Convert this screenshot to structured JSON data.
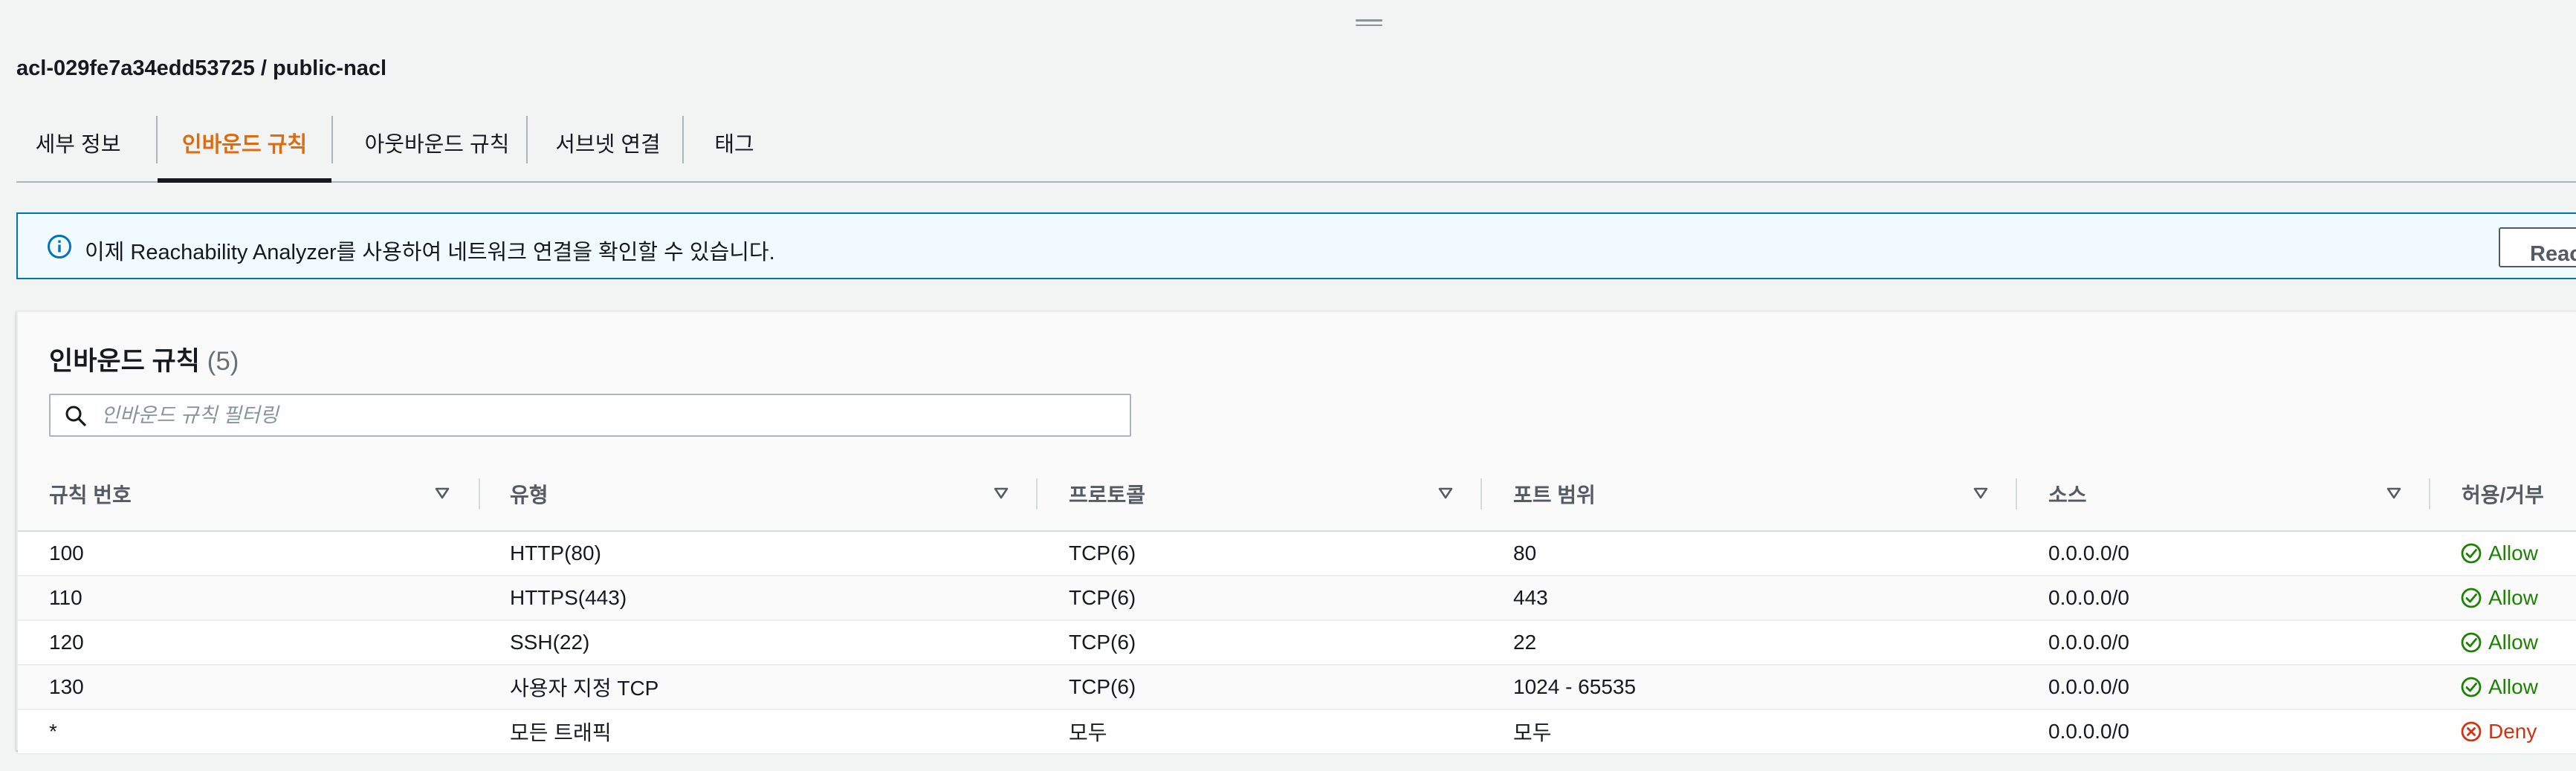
{
  "header": {
    "title": "acl-029fe7a34edd53725 / public-nacl"
  },
  "tabs": [
    {
      "label": "세부 정보",
      "active": false
    },
    {
      "label": "인바운드 규칙",
      "active": true
    },
    {
      "label": "아웃바운드 규칙",
      "active": false
    },
    {
      "label": "서브넷 연결",
      "active": false
    },
    {
      "label": "태그",
      "active": false
    }
  ],
  "flash": {
    "icon": "info-icon",
    "message": "이제 Reachability Analyzer를 사용하여 네트워크 연결을 확인할 수 있습니다.",
    "button_label": "Reachability Analyzer 실행"
  },
  "panel": {
    "title": "인바운드 규칙",
    "count": "(5)",
    "filter_placeholder": "인바운드 규칙 필터링",
    "filter_value": ""
  },
  "table": {
    "columns": [
      "규칙 번호",
      "유형",
      "프로토콜",
      "포트 범위",
      "소스",
      "허용/거부"
    ],
    "rows": [
      {
        "rule": "100",
        "type": "HTTP(80)",
        "protocol": "TCP(6)",
        "port": "80",
        "source": "0.0.0.0/0",
        "action": "Allow"
      },
      {
        "rule": "110",
        "type": "HTTPS(443)",
        "protocol": "TCP(6)",
        "port": "443",
        "source": "0.0.0.0/0",
        "action": "Allow"
      },
      {
        "rule": "120",
        "type": "SSH(22)",
        "protocol": "TCP(6)",
        "port": "22",
        "source": "0.0.0.0/0",
        "action": "Allow"
      },
      {
        "rule": "130",
        "type": "사용자 지정 TCP",
        "protocol": "TCP(6)",
        "port": "1024 - 65535",
        "source": "0.0.0.0/0",
        "action": "Allow"
      },
      {
        "rule": "*",
        "type": "모든 트래픽",
        "protocol": "모두",
        "port": "모두",
        "source": "0.0.0.0/0",
        "action": "Deny"
      }
    ]
  },
  "colors": {
    "accent": "#dd6b10",
    "info_border": "#0073bb",
    "allow": "#1d8102",
    "deny": "#d13212"
  }
}
